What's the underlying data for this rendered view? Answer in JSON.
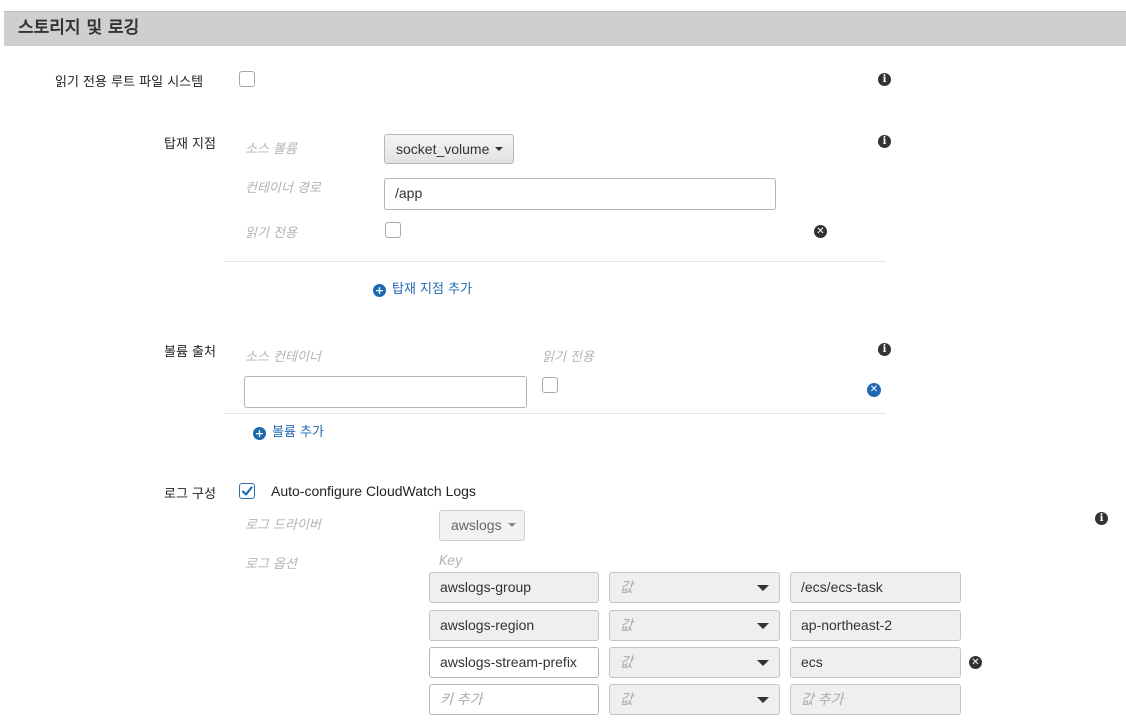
{
  "section": {
    "title": "스토리지 및 로깅"
  },
  "readonly_root": {
    "label": "읽기 전용 루트 파일 시스템",
    "checked": false
  },
  "mount_points": {
    "label": "탑재 지점",
    "source_volume_label": "소스 볼륨",
    "source_volume_value": "socket_volume",
    "container_path_label": "컨테이너 경로",
    "container_path_value": "/app",
    "readonly_label": "읽기 전용",
    "readonly_checked": false,
    "add_label": "탑재 지점 추가"
  },
  "volumes_from": {
    "label": "볼륨 출처",
    "source_container_label": "소스 컨테이너",
    "source_container_value": "",
    "readonly_label": "읽기 전용",
    "readonly_checked": false,
    "add_label": "볼륨 추가"
  },
  "log_config": {
    "label": "로그 구성",
    "auto_configure_label": "Auto-configure CloudWatch Logs",
    "auto_configure_checked": true,
    "driver_label": "로그 드라이버",
    "driver_value": "awslogs",
    "options_label": "로그 옵션",
    "key_header": "Key",
    "options": [
      {
        "key": "awslogs-group",
        "type": "값",
        "value": "/ecs/ecs-task"
      },
      {
        "key": "awslogs-region",
        "type": "값",
        "value": "ap-northeast-2"
      },
      {
        "key": "awslogs-stream-prefix",
        "type": "값",
        "value": "ecs"
      }
    ],
    "new_option": {
      "key_placeholder": "키 추가",
      "type": "값",
      "value_placeholder": "값 추가"
    }
  },
  "icons": {
    "info": "i",
    "remove": "✕",
    "add": "+"
  },
  "colors": {
    "accent": "#1f69b3",
    "header_bg": "#cfcfcf"
  }
}
